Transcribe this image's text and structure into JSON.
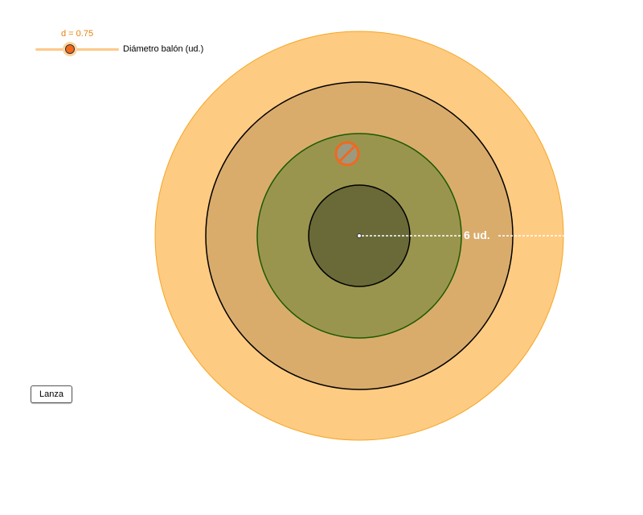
{
  "slider": {
    "value_text": "d = 0.75",
    "value": 0.75,
    "label": "Diámetro balón (ud.)"
  },
  "button": {
    "label": "Lanza"
  },
  "target": {
    "distance_label": "6 ud.",
    "colors": {
      "outer_ring": "#fecb82",
      "outer_ring_border": "#f5a623",
      "second_ring": "#d9ac6c",
      "third_ring": "#9a954e",
      "third_ring_border": "#1c5a00",
      "center": "#696a38",
      "ball": "#f0691e"
    }
  }
}
